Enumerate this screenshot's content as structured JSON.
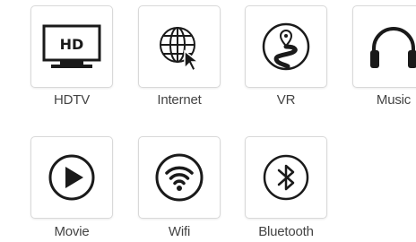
{
  "colors": {
    "icon": "#1a1a1a",
    "tile_border": "#d9d9d9",
    "label_text": "#444444",
    "background": "#ffffff"
  },
  "tiles": [
    {
      "name": "hdtv",
      "label": "HDTV",
      "icon": "tv-icon",
      "icon_text": "HD"
    },
    {
      "name": "internet",
      "label": "Internet",
      "icon": "globe-cursor-icon"
    },
    {
      "name": "vr",
      "label": "VR",
      "icon": "route-pin-icon"
    },
    {
      "name": "music",
      "label": "Music",
      "icon": "headphones-icon"
    },
    {
      "name": "movie",
      "label": "Movie",
      "icon": "play-icon"
    },
    {
      "name": "wifi",
      "label": "Wifi",
      "icon": "wifi-icon"
    },
    {
      "name": "bluetooth",
      "label": "Bluetooth",
      "icon": "bluetooth-icon"
    }
  ]
}
